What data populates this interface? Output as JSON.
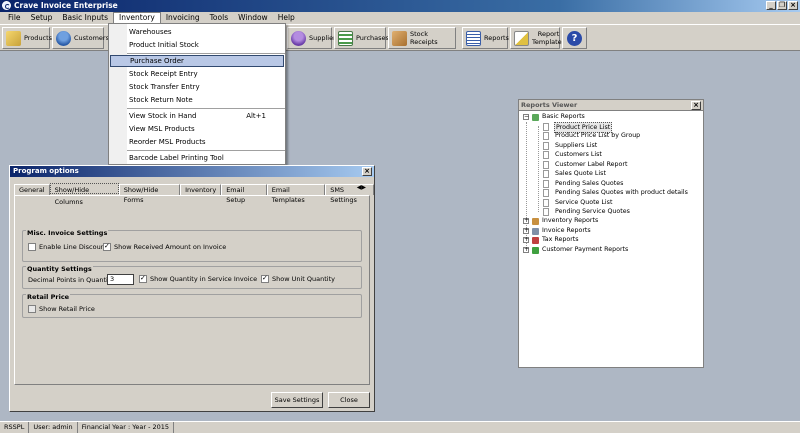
{
  "window": {
    "title": "Crave Invoice Enterprise"
  },
  "menu": [
    "File",
    "Setup",
    "Basic Inputs",
    "Inventory",
    "Invoicing",
    "Tools",
    "Window",
    "Help"
  ],
  "toolbar": {
    "products": "Products",
    "customers": "Customers",
    "suppliers": "Suppliers",
    "purchases": "Purchases",
    "stock_receipts": "Stock Receipts",
    "reports": "Reports",
    "report_templates_1": "Report",
    "report_templates_2": "Templates"
  },
  "inventory_menu": {
    "warehouses": "Warehouses",
    "product_initial_stock": "Product Initial Stock",
    "purchase_order": "Purchase Order",
    "stock_receipt_entry": "Stock Receipt Entry",
    "stock_transfer_entry": "Stock Transfer Entry",
    "stock_return_note": "Stock Return Note",
    "view_stock_in_hand": "View Stock in Hand",
    "view_stock_in_hand_shortcut": "Alt+1",
    "view_msl_products": "View MSL Products",
    "reorder_msl_products": "Reorder MSL Products",
    "barcode_label_printing_tool": "Barcode Label Printing Tool"
  },
  "program_options": {
    "title": "Program options",
    "tabs": [
      "General",
      "Show/Hide Columns",
      "Show/Hide Forms",
      "Inventory",
      "Email Setup",
      "Email Templates",
      "SMS Settings"
    ],
    "misc": {
      "title": "Misc. Invoice Settings",
      "enable_line_discount": "Enable Line Discount",
      "show_received_amount": "Show Received Amount on Invoice"
    },
    "quantity": {
      "title": "Quantity Settings",
      "decimal_points_label": "Decimal Points in Quantity",
      "decimal_points_value": "3",
      "show_qty_service_invoice": "Show Quantity in Service Invoice",
      "show_unit_quantity": "Show Unit Quantity"
    },
    "retail": {
      "title": "Retail Price",
      "show_retail_price": "Show Retail Price"
    },
    "save_settings": "Save Settings",
    "close": "Close"
  },
  "reports_viewer": {
    "title": "Reports Viewer",
    "basic_reports": "Basic Reports",
    "basic_items": [
      "Product Price List",
      "Product Price List by Group",
      "Suppliers List",
      "Customers List",
      "Customer Label Report",
      "Sales Quote List",
      "Pending Sales Quotes",
      "Pending Sales Quotes with product details",
      "Service Quote List",
      "Pending Service Quotes"
    ],
    "inventory_reports": "Inventory Reports",
    "invoice_reports": "Invoice Reports",
    "tax_reports": "Tax Reports",
    "customer_payment_reports": "Customer Payment Reports"
  },
  "status": {
    "company": "RSSPL",
    "user": "User: admin",
    "financial_year": "Financial Year : Year - 2015"
  }
}
